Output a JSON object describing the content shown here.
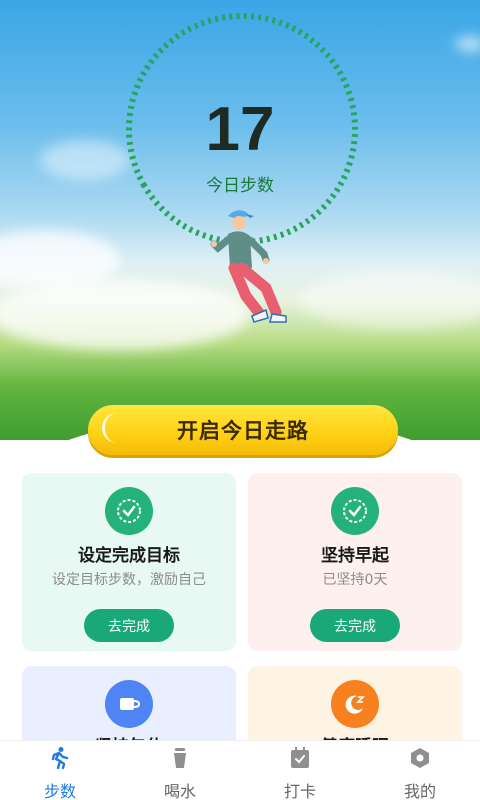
{
  "hero": {
    "steps_value": "17",
    "steps_label": "今日步数",
    "cta_label": "开启今日走路"
  },
  "cards": [
    {
      "title": "设定完成目标",
      "subtitle": "设定目标步数，激励自己",
      "button": "去完成",
      "icon": "check-shield-icon",
      "accent": "#24b17a"
    },
    {
      "title": "坚持早起",
      "subtitle": "已坚持0天",
      "button": "去完成",
      "icon": "check-shield-icon",
      "accent": "#24b17a"
    },
    {
      "title": "坚持午休",
      "icon": "cup-icon",
      "accent": "#4f84f4"
    },
    {
      "title": "健康睡眠",
      "icon": "sleep-icon",
      "accent": "#f7811f"
    }
  ],
  "tabs": [
    {
      "label": "步数",
      "icon": "walking-icon",
      "active": true
    },
    {
      "label": "喝水",
      "icon": "drink-cup-icon",
      "active": false
    },
    {
      "label": "打卡",
      "icon": "calendar-check-icon",
      "active": false
    },
    {
      "label": "我的",
      "icon": "profile-hex-icon",
      "active": false
    }
  ],
  "colors": {
    "tab_active": "#1f7be0",
    "button_green": "#19a877",
    "cta_yellow": "#ffd014"
  }
}
